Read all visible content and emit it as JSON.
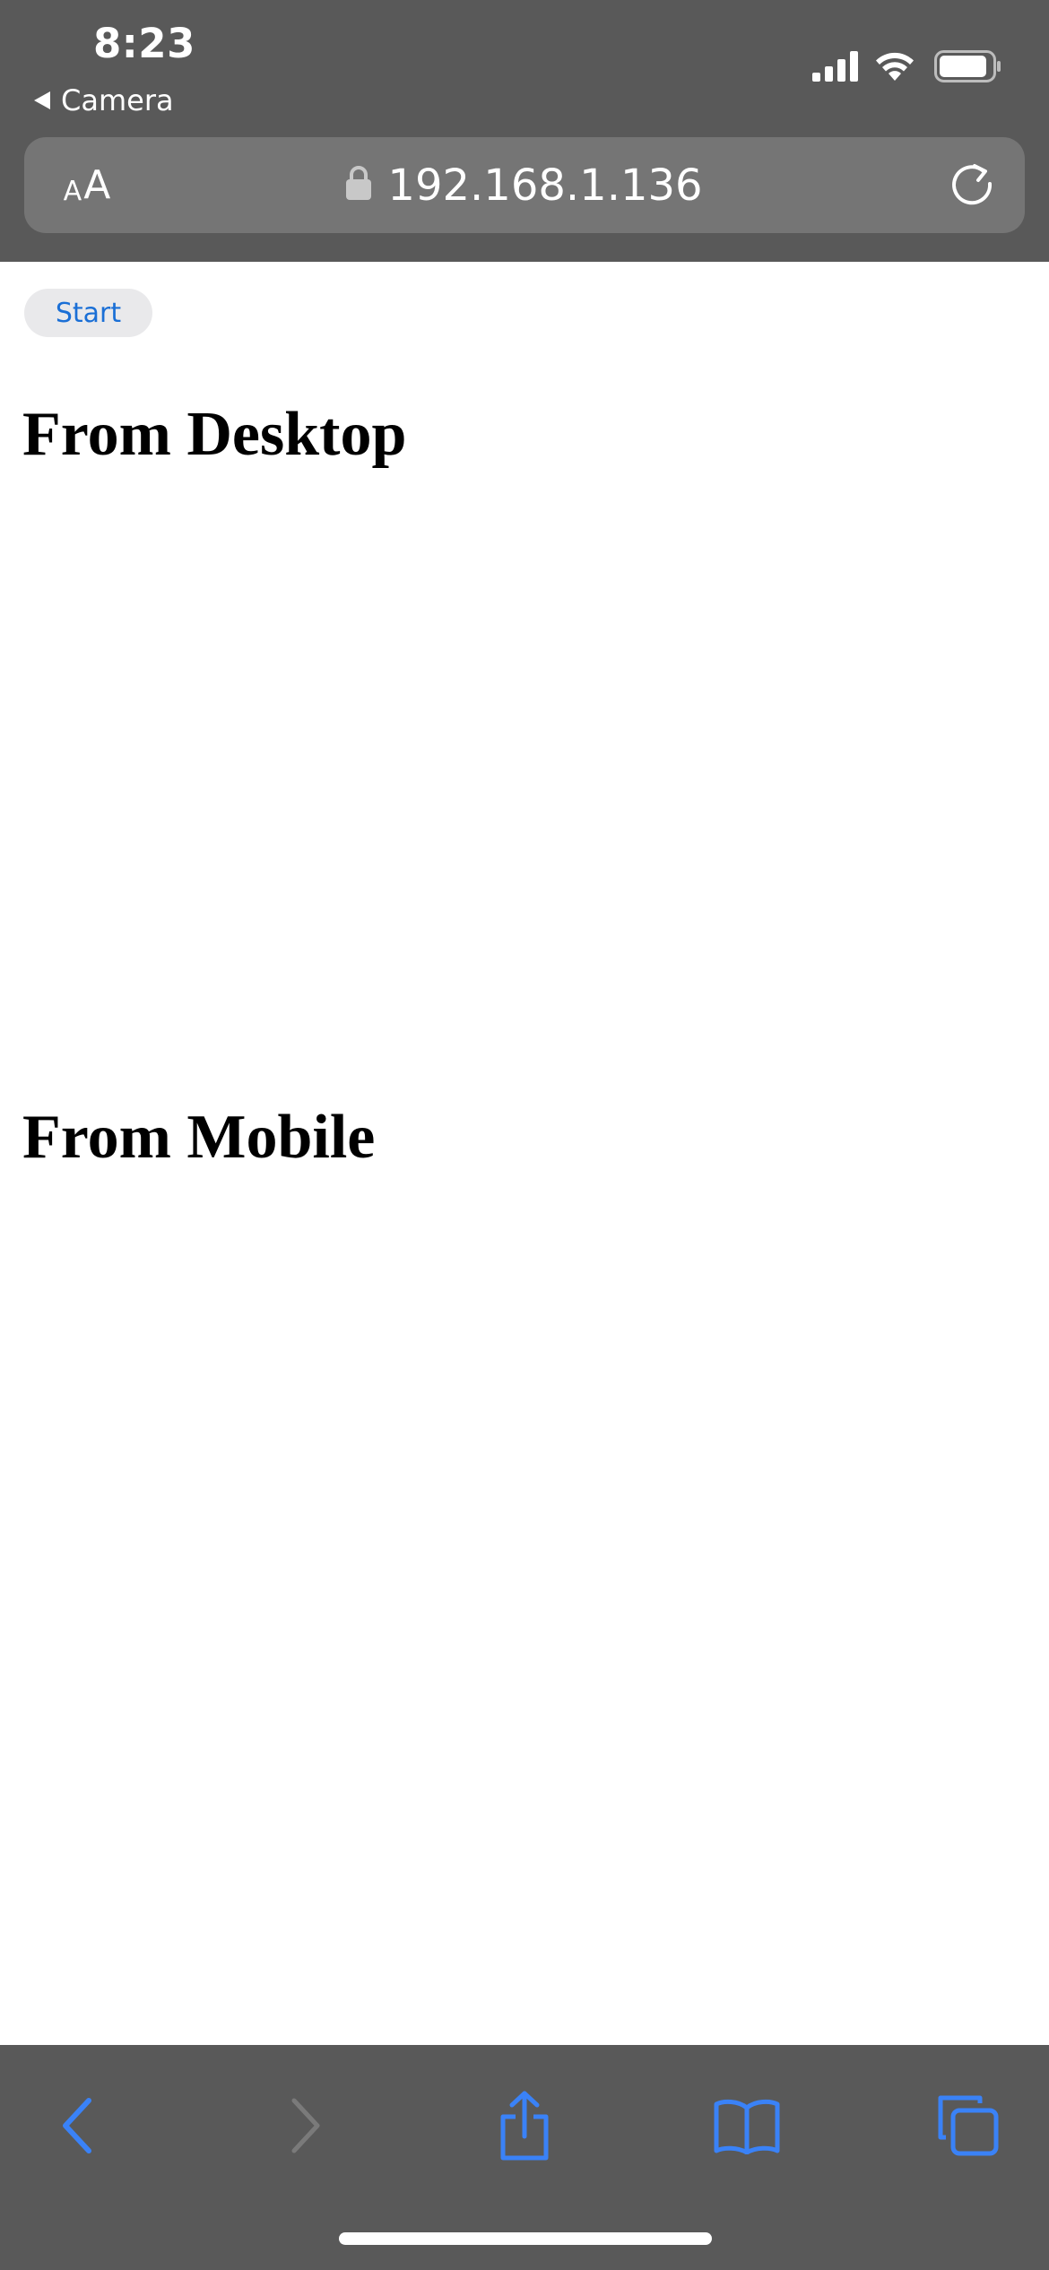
{
  "status_bar": {
    "time": "8:23",
    "back_app_label": "Camera"
  },
  "browser": {
    "text_size_small": "A",
    "text_size_large": "A",
    "url": "192.168.1.136"
  },
  "page": {
    "start_button_label": "Start",
    "heading_desktop": "From Desktop",
    "heading_mobile": "From Mobile"
  },
  "icons": {
    "signal": "cellular-signal-icon",
    "wifi": "wifi-icon",
    "battery": "battery-icon",
    "lock": "lock-icon",
    "reload": "reload-icon",
    "back": "chevron-left-icon",
    "forward": "chevron-right-icon",
    "share": "share-icon",
    "bookmarks": "book-icon",
    "tabs": "tabs-icon"
  },
  "colors": {
    "chrome_background": "#595959",
    "url_bar_background": "#757575",
    "toolbar_accent": "#3a82f7",
    "toolbar_disabled": "#7a7a7a",
    "link_blue": "#1a6fd6",
    "start_button_background": "#e9e9eb"
  }
}
